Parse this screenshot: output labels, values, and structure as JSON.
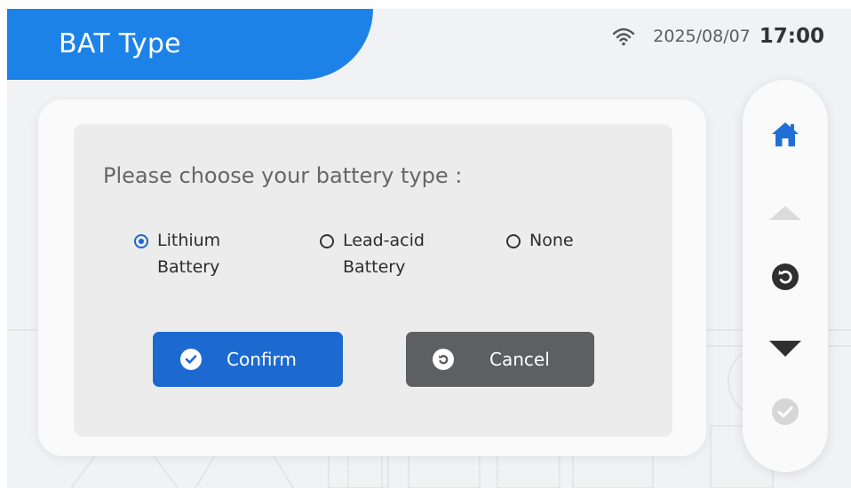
{
  "header": {
    "title": "BAT Type",
    "date": "2025/08/07",
    "time": "17:00",
    "wifi_icon": "wifi-icon"
  },
  "dialog": {
    "prompt": "Please choose your battery type :",
    "options": [
      {
        "line1": "Lithium",
        "line2": "Battery",
        "selected": true
      },
      {
        "line1": "Lead-acid",
        "line2": "Battery",
        "selected": false
      },
      {
        "line1": "None",
        "line2": "",
        "selected": false
      }
    ],
    "confirm_label": "Confirm",
    "cancel_label": "Cancel"
  },
  "nav": {
    "items": [
      "home-icon",
      "arrow-up-icon",
      "back-icon",
      "arrow-down-icon",
      "check-icon"
    ]
  },
  "colors": {
    "accent": "#1d82e8",
    "confirm": "#1c6ad0",
    "cancel": "#5e5f61",
    "home": "#1f6fd6"
  }
}
